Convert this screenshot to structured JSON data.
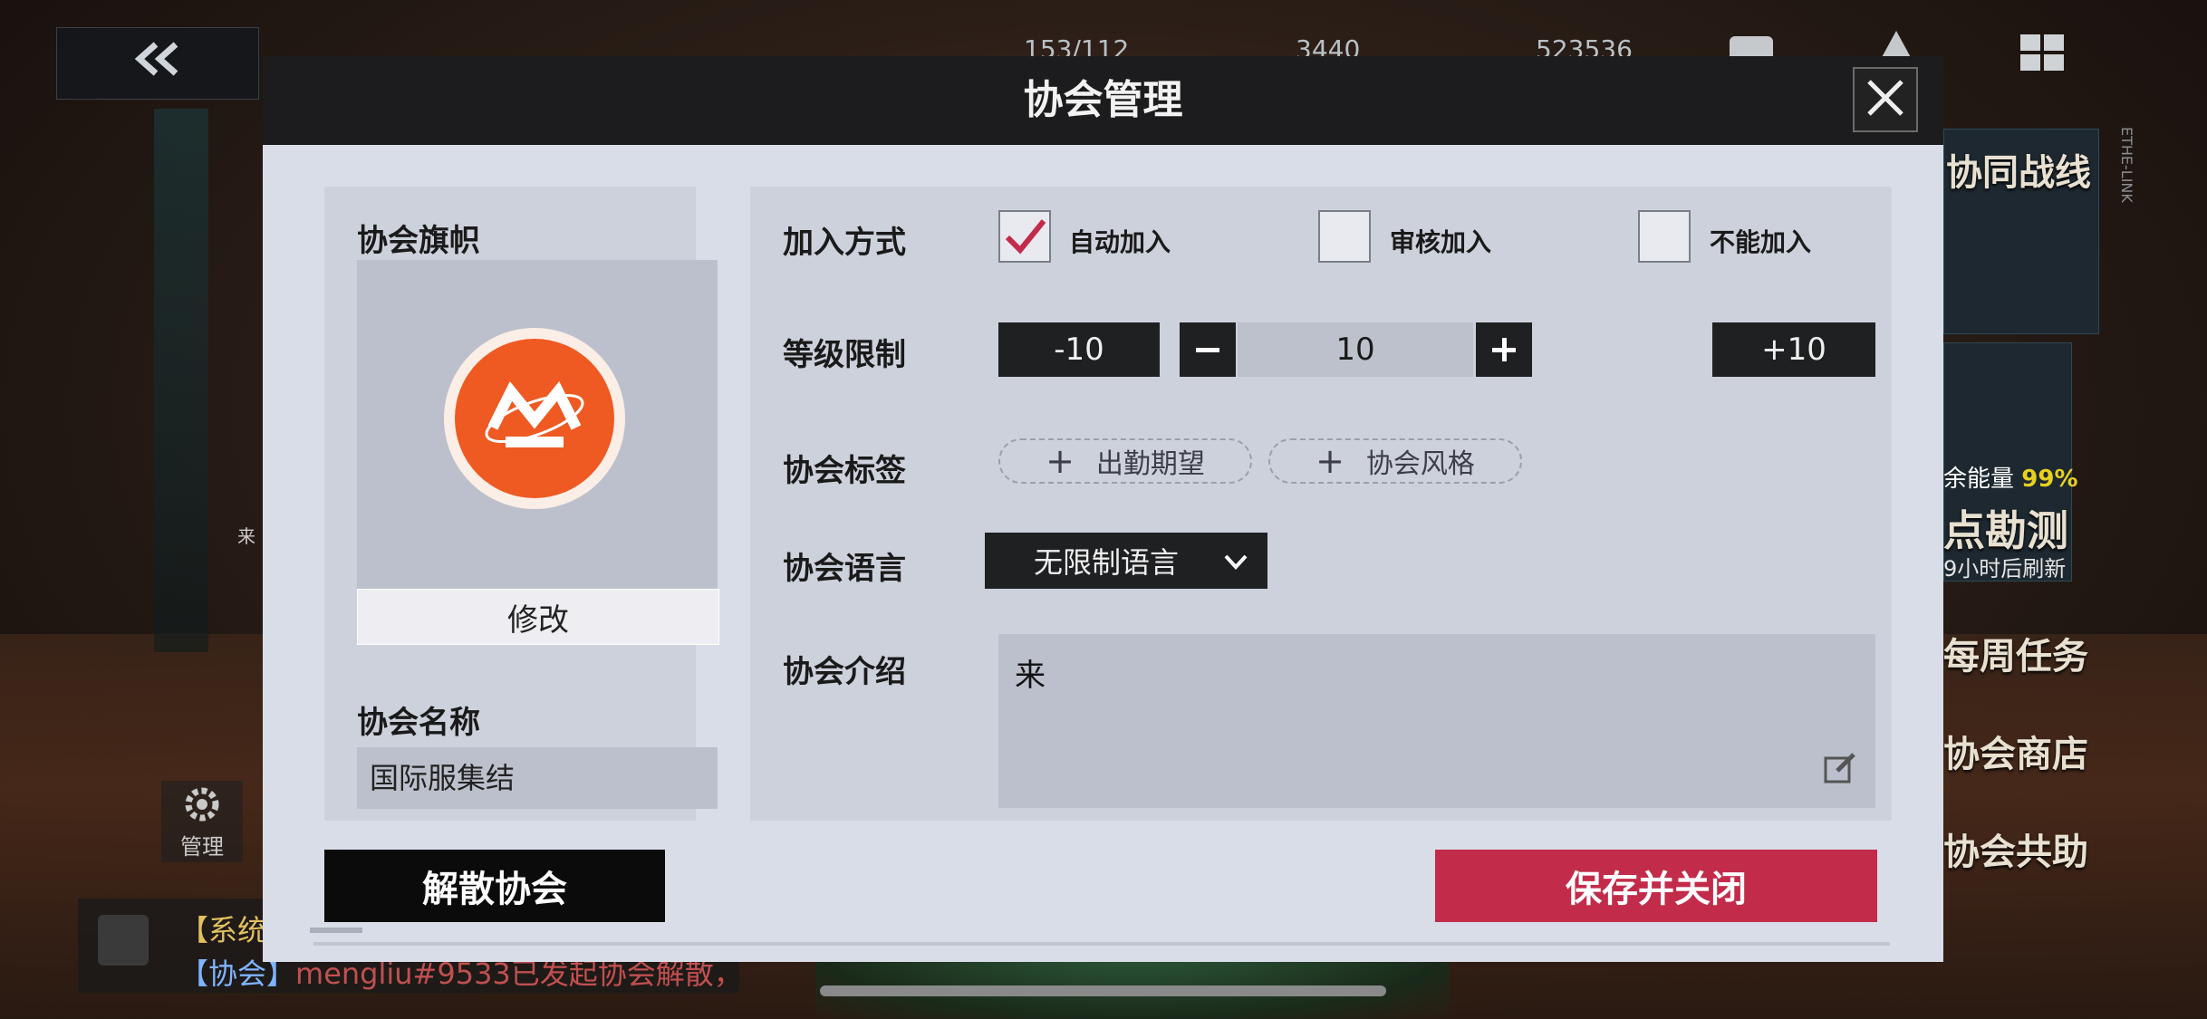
{
  "background": {
    "top_resources": [
      "153/112",
      "3440",
      "523536"
    ],
    "right_side": {
      "collab_front": "协同战线",
      "energy_label": "余能量",
      "energy_value": "99%",
      "survey_title": "点勘测",
      "refresh_note": "9小时后刷新",
      "weekly_task": "每周任务",
      "guild_shop": "协会商店",
      "guild_assist": "协会共助",
      "vertical_label": "ETHE-LINK"
    },
    "left_side": {
      "manage_label": "管理",
      "small_char": "来"
    },
    "chat": {
      "line1_prefix": "【系统",
      "line2_prefix": "【协会】",
      "line2_text": "mengliu#9533已发起协会解散，"
    },
    "back_icon": "double-chevron-left-icon",
    "accent_colors": {
      "confirm": "#c32b4a",
      "checkmark": "#c32b4a",
      "emblem": "#ee5a22"
    }
  },
  "modal": {
    "title": "协会管理",
    "close_icon": "close-icon",
    "banner": {
      "label": "协会旗帜",
      "edit_label": "修改"
    },
    "name": {
      "label": "协会名称",
      "value": "国际服集结"
    },
    "join": {
      "label": "加入方式",
      "options": [
        {
          "label": "自动加入",
          "checked": true
        },
        {
          "label": "审核加入",
          "checked": false
        },
        {
          "label": "不能加入",
          "checked": false
        }
      ]
    },
    "level": {
      "label": "等级限制",
      "minus10": "-10",
      "value": "10",
      "plus10": "+10"
    },
    "tags": {
      "label": "协会标签",
      "items": [
        "出勤期望",
        "协会风格"
      ]
    },
    "language": {
      "label": "协会语言",
      "selected": "无限制语言"
    },
    "intro": {
      "label": "协会介绍",
      "value": "来"
    },
    "footer": {
      "disband_label": "解散协会",
      "save_label": "保存并关闭"
    }
  }
}
